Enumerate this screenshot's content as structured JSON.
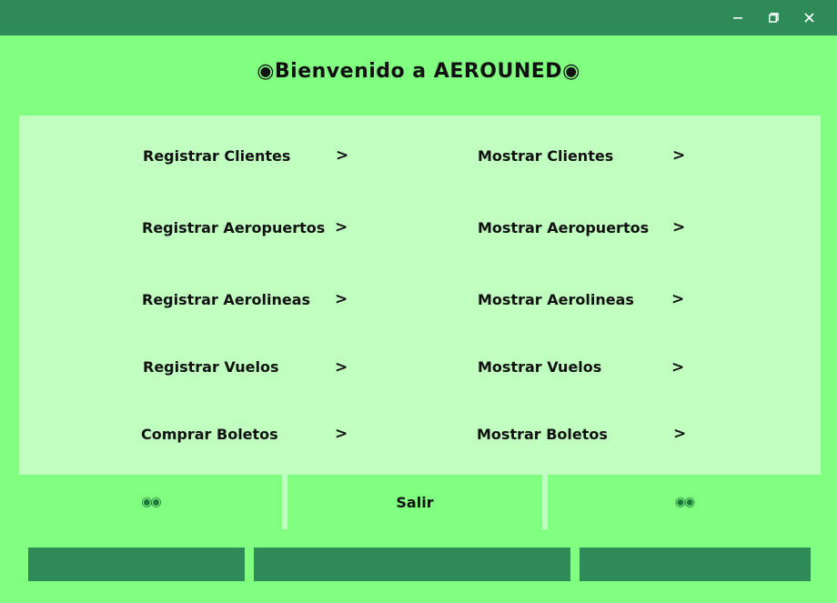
{
  "window": {
    "minimize_icon": "minimize-icon",
    "restore_icon": "restore-icon",
    "close_icon": "close-icon"
  },
  "header": {
    "title": "◉Bienvenido a AEROUNED◉"
  },
  "menu": {
    "left": [
      {
        "label": "Registrar Clientes",
        "arrow": ">"
      },
      {
        "label": "Registrar Aeropuertos",
        "arrow": ">"
      },
      {
        "label": "Registrar Aerolineas",
        "arrow": ">"
      },
      {
        "label": "Registrar Vuelos",
        "arrow": ">"
      },
      {
        "label": "Comprar Boletos",
        "arrow": ">"
      }
    ],
    "right": [
      {
        "label": "Mostrar Clientes",
        "arrow": ">"
      },
      {
        "label": "Mostrar Aeropuertos",
        "arrow": ">"
      },
      {
        "label": "Mostrar Aerolineas",
        "arrow": ">"
      },
      {
        "label": "Mostrar Vuelos",
        "arrow": ">"
      },
      {
        "label": "Mostrar Boletos",
        "arrow": ">"
      }
    ]
  },
  "footer": {
    "left_deco": "◉◉",
    "exit_label": "Salir",
    "right_deco": "◉◉"
  },
  "colors": {
    "titlebar": "#2e8b57",
    "background": "#80ff80",
    "panel": "#c0ffc0"
  }
}
